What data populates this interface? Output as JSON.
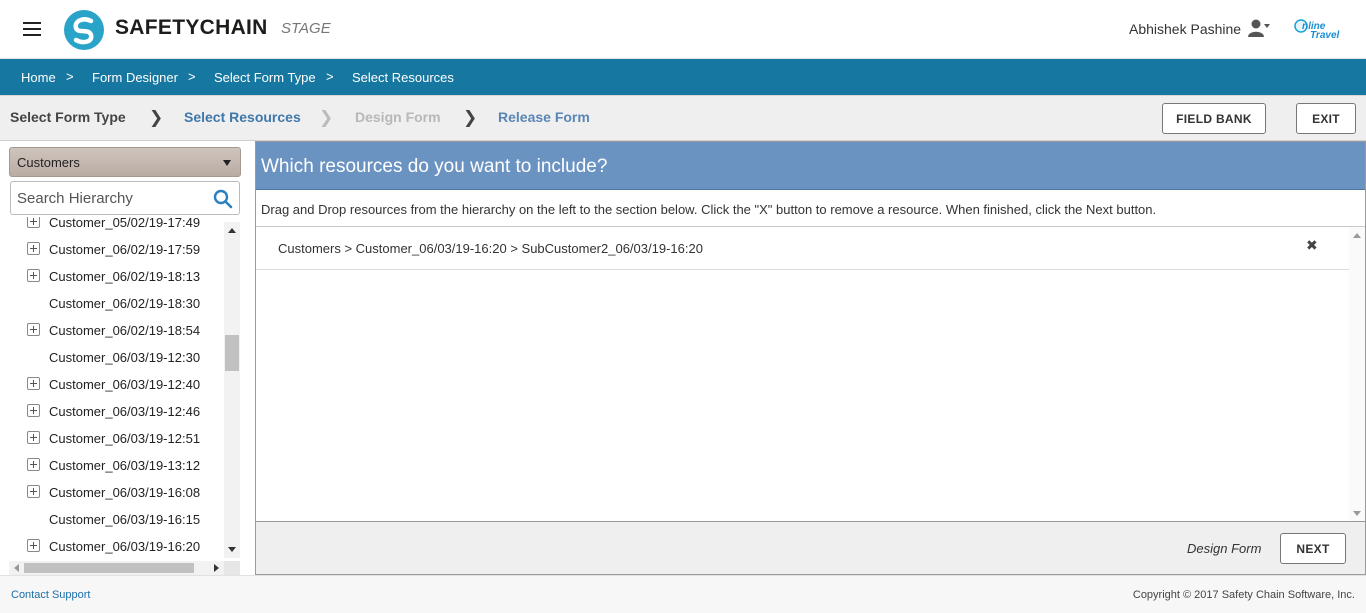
{
  "header": {
    "logo_text": "SAFETYCHAIN",
    "environment": "STAGE",
    "username": "Abhishek Pashine",
    "menu_icon": "hamburger-menu-icon",
    "user_icon": "user-profile-icon",
    "brand_logo": "online-travel-logo"
  },
  "breadcrumb": {
    "items": [
      "Home",
      "Form Designer",
      "Select Form Type",
      "Select Resources"
    ],
    "separator": ">"
  },
  "steps": {
    "items": [
      {
        "label": "Select Form Type",
        "state": "completed"
      },
      {
        "label": "Select Resources",
        "state": "active"
      },
      {
        "label": "Design Form",
        "state": "disabled"
      },
      {
        "label": "Release Form",
        "state": "upcoming"
      }
    ],
    "field_bank_label": "FIELD BANK",
    "exit_label": "EXIT"
  },
  "left_panel": {
    "dropdown_value": "Customers",
    "search_placeholder": "Search Hierarchy",
    "tree_items": [
      {
        "label": "Customer_05/02/19-17:49",
        "expandable": true
      },
      {
        "label": "Customer_06/02/19-17:59",
        "expandable": true
      },
      {
        "label": "Customer_06/02/19-18:13",
        "expandable": true
      },
      {
        "label": "Customer_06/02/19-18:30",
        "expandable": false
      },
      {
        "label": "Customer_06/02/19-18:54",
        "expandable": true
      },
      {
        "label": "Customer_06/03/19-12:30",
        "expandable": false
      },
      {
        "label": "Customer_06/03/19-12:40",
        "expandable": true
      },
      {
        "label": "Customer_06/03/19-12:46",
        "expandable": true
      },
      {
        "label": "Customer_06/03/19-12:51",
        "expandable": true
      },
      {
        "label": "Customer_06/03/19-13:12",
        "expandable": true
      },
      {
        "label": "Customer_06/03/19-16:08",
        "expandable": true
      },
      {
        "label": "Customer_06/03/19-16:15",
        "expandable": false
      },
      {
        "label": "Customer_06/03/19-16:20",
        "expandable": true
      }
    ]
  },
  "main": {
    "title": "Which resources do you want to include?",
    "instructions": "Drag and Drop resources from the hierarchy on the left to the section below. Click the \"X\" button to remove a resource. When finished, click the Next button.",
    "resources": [
      {
        "path": "Customers > Customer_06/03/19-16:20 > SubCustomer2_06/03/19-16:20",
        "remove_icon": "close-x-icon"
      }
    ],
    "footer_label": "Design Form",
    "next_label": "NEXT"
  },
  "footer": {
    "contact_label": "Contact Support",
    "copyright": "Copyright © 2017 Safety Chain Software, Inc."
  },
  "colors": {
    "breadcrumb_bg": "#1677a0",
    "header_panel_bg": "#6b93c1",
    "active_step": "#3f78ab",
    "disabled_step": "#b8b8b8",
    "logo_teal": "#2aa3c9"
  }
}
